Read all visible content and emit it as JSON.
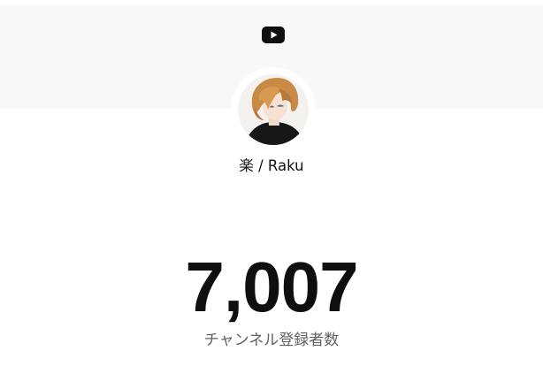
{
  "header": {
    "logo_icon": "youtube-play-icon",
    "banner_color": "#f8f8f8",
    "logo_color": "#0f0f0f"
  },
  "channel": {
    "name": "楽 / Raku",
    "avatar_icon": "channel-avatar-anime-boy"
  },
  "stats": {
    "subscriber_count": "7,007",
    "subscriber_label": "チャンネル登録者数"
  }
}
